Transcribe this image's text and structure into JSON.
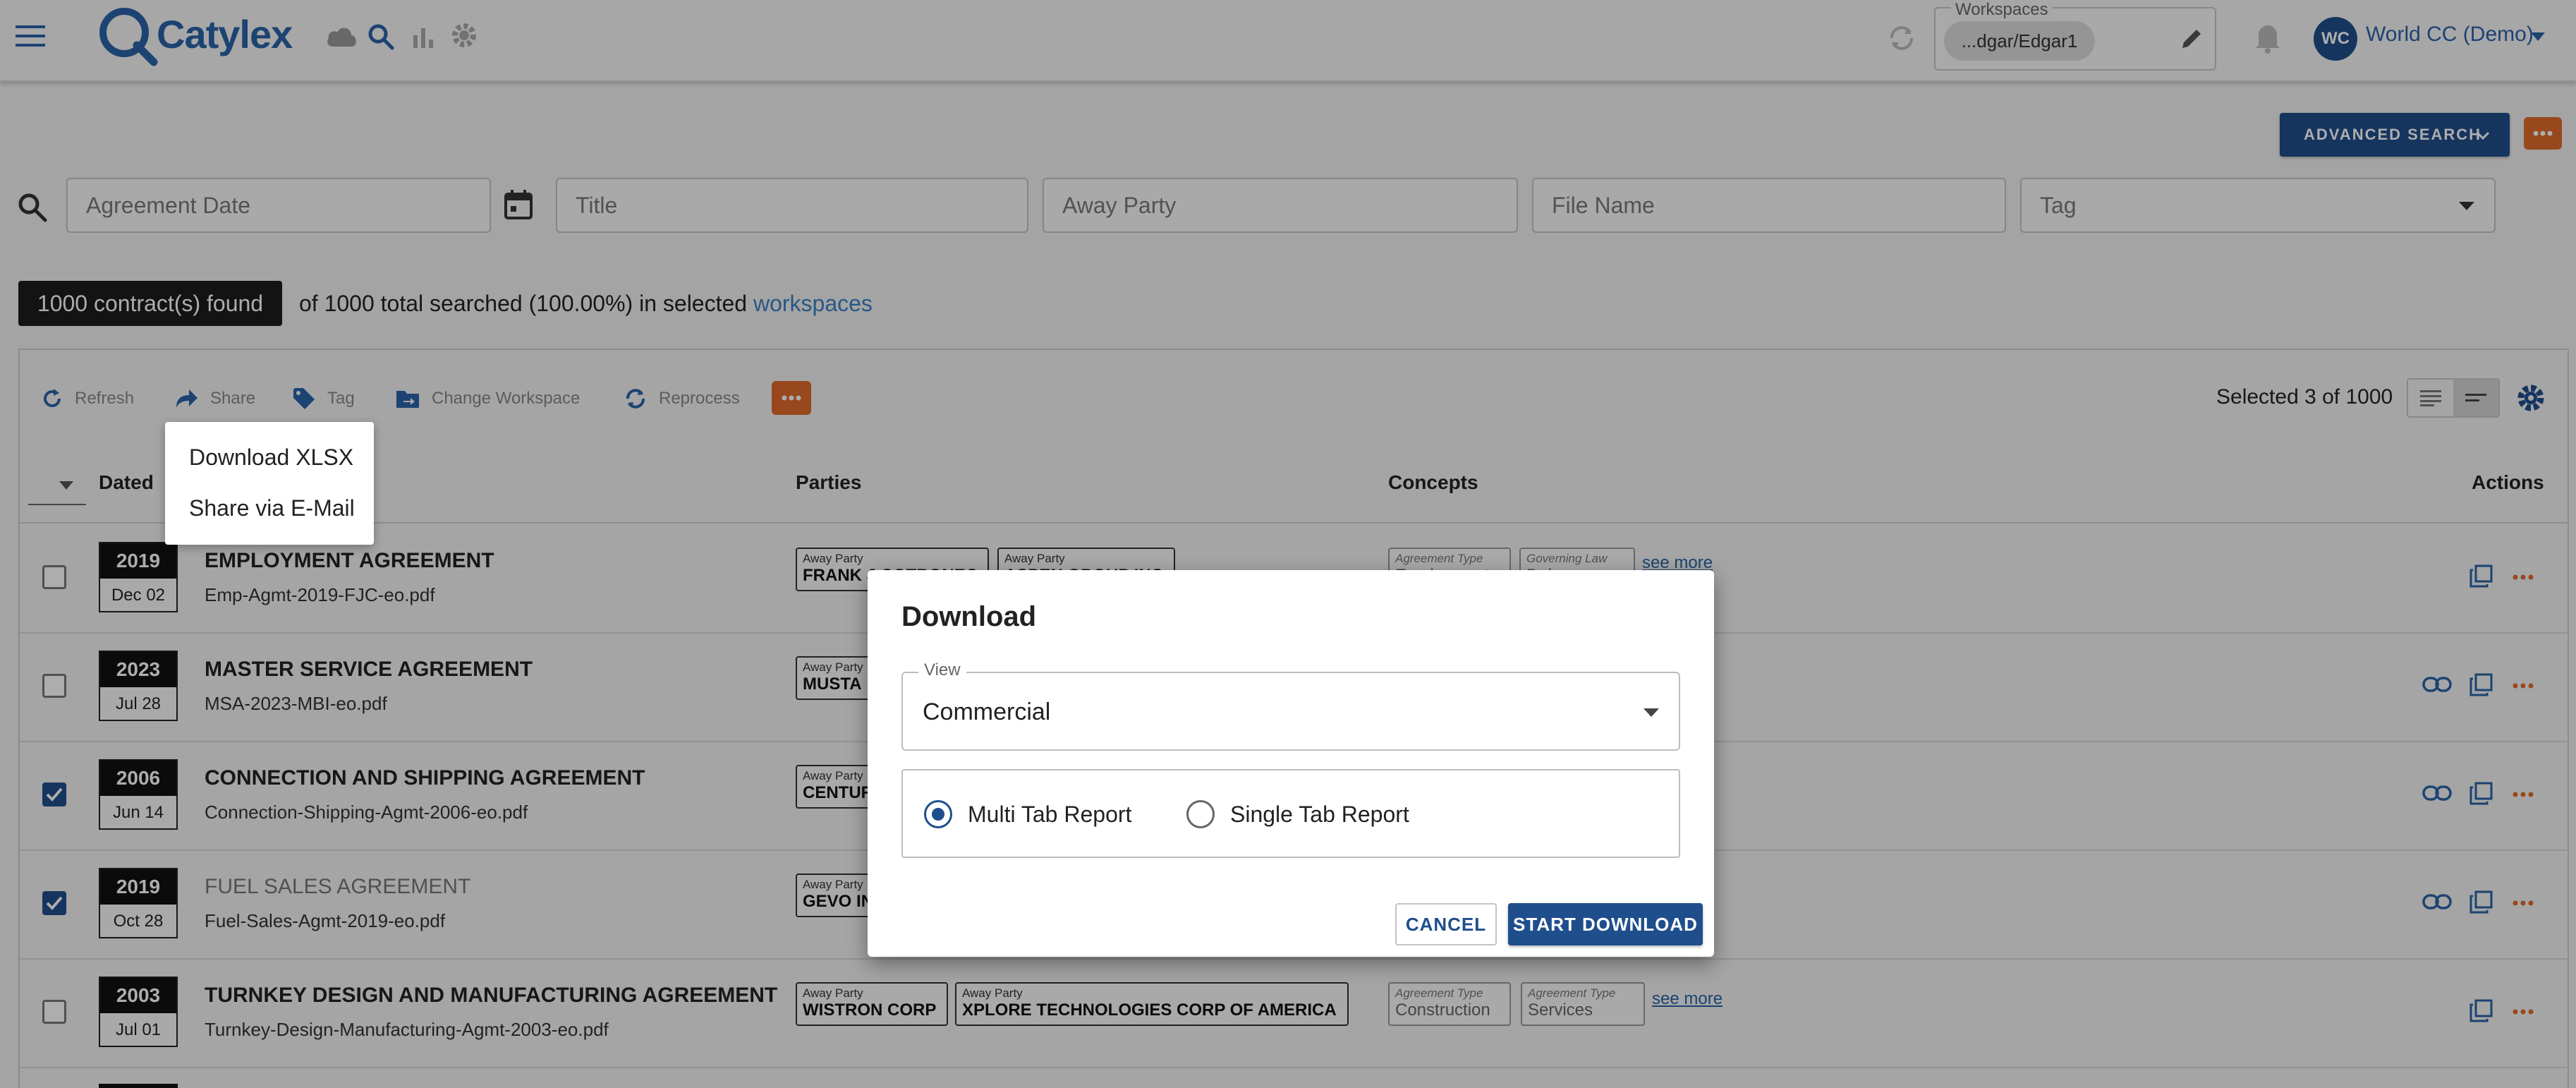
{
  "app": {
    "brand": "Catylex"
  },
  "workspace": {
    "legend": "Workspaces",
    "value": "...dgar/Edgar1"
  },
  "user": {
    "initials": "WC",
    "name": "World CC (Demo)"
  },
  "search": {
    "advanced_label": "ADVANCED SEARCH",
    "agreement_date_placeholder": "Agreement Date",
    "title_placeholder": "Title",
    "away_party_placeholder": "Away Party",
    "file_name_placeholder": "File Name",
    "tag_placeholder": "Tag"
  },
  "results": {
    "found": "1000 contract(s) found",
    "summary_text": "of 1000 total searched (100.00%) in selected",
    "workspaces_link": "workspaces",
    "selected": "Selected 3 of 1000"
  },
  "toolbar": {
    "refresh": "Refresh",
    "share": "Share",
    "tag": "Tag",
    "change_workspace": "Change Workspace",
    "reprocess": "Reprocess"
  },
  "share_menu": {
    "items": [
      "Download XLSX",
      "Share via E-Mail"
    ]
  },
  "table": {
    "headers": {
      "dated": "Dated",
      "parties": "Parties",
      "concepts": "Concepts",
      "actions": "Actions"
    },
    "see_more": "see more",
    "rows": [
      {
        "year": "2019",
        "day": "Dec 02",
        "title": "EMPLOYMENT AGREEMENT",
        "file": "Emp-Agmt-2019-FJC-eo.pdf",
        "checked": false,
        "party1_label": "Away Party",
        "party1": "FRANK J COTRONEO",
        "party2_label": "Away Party",
        "party2": "ASPEN GROUP INC",
        "concept1_label": "Agreement Type",
        "concept1": "Employment",
        "concept2_label": "Governing Law",
        "concept2": "Delaware"
      },
      {
        "year": "2023",
        "day": "Jul 28",
        "title": "MASTER SERVICE AGREEMENT",
        "file": "MSA-2023-MBI-eo.pdf",
        "checked": false,
        "party1_label": "Away Party",
        "party1": "MUSTA"
      },
      {
        "year": "2006",
        "day": "Jun 14",
        "title": "CONNECTION AND SHIPPING AGREEMENT",
        "file": "Connection-Shipping-Agmt-2006-eo.pdf",
        "checked": true,
        "party1_label": "Away Party",
        "party1": "CENTUR"
      },
      {
        "year": "2019",
        "day": "Oct 28",
        "title": "FUEL SALES AGREEMENT",
        "file": "Fuel-Sales-Agmt-2019-eo.pdf",
        "checked": true,
        "party1_label": "Away Party",
        "party1": "GEVO IN"
      },
      {
        "year": "2003",
        "day": "Jul 01",
        "title": "TURNKEY DESIGN AND MANUFACTURING AGREEMENT",
        "file": "Turnkey-Design-Manufacturing-Agmt-2003-eo.pdf",
        "checked": false,
        "party1_label": "Away Party",
        "party1": "WISTRON CORP",
        "party2_label": "Away Party",
        "party2": "XPLORE TECHNOLOGIES CORP OF AMERICA",
        "concept1_label": "Agreement Type",
        "concept1": "Construction",
        "concept2_label": "Agreement Type",
        "concept2": "Services"
      }
    ]
  },
  "dialog": {
    "title": "Download",
    "view_label": "View",
    "view_value": "Commercial",
    "option_multi": "Multi Tab Report",
    "option_single": "Single Tab Report",
    "cancel": "CANCEL",
    "start": "START DOWNLOAD"
  },
  "colors": {
    "primary": "#1f4e8c",
    "accent": "#e06a2a",
    "link": "#3b82c4"
  }
}
